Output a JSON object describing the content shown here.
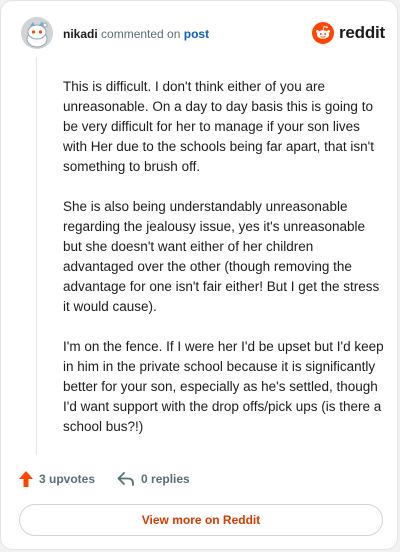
{
  "header": {
    "username": "nikadi",
    "action_text": "commented on",
    "post_link": "post",
    "brand_name": "reddit",
    "brand_color": "#ff4500"
  },
  "comment": {
    "paragraphs": [
      "This is difficult. I don't think either of you are unreasonable. On a day to day basis this is going to be very difficult for her to manage if your son lives with Her due to the schools being far apart, that isn't something to brush off.",
      "She is also being understandably unreasonable regarding the jealousy issue, yes it's unreasonable but she doesn't want either of her children advantaged over the other (though removing the advantage for one isn't fair either! But I get the stress it would cause).",
      "I'm on the fence. If I were her I'd be upset but I'd keep in him in the private school because it is significantly better for your son, especially as he's settled, though I'd want support with the drop offs/pick ups (is there a school bus?!)"
    ]
  },
  "footer": {
    "upvotes_label": "3 upvotes",
    "replies_label": "0 replies",
    "view_more_label": "View more on Reddit",
    "accent_color": "#d93a00"
  },
  "icons": {
    "avatar": "snoo-avatar-icon",
    "brand": "reddit-logo-icon",
    "upvote": "upvote-arrow-icon",
    "reply": "reply-arrow-icon"
  }
}
